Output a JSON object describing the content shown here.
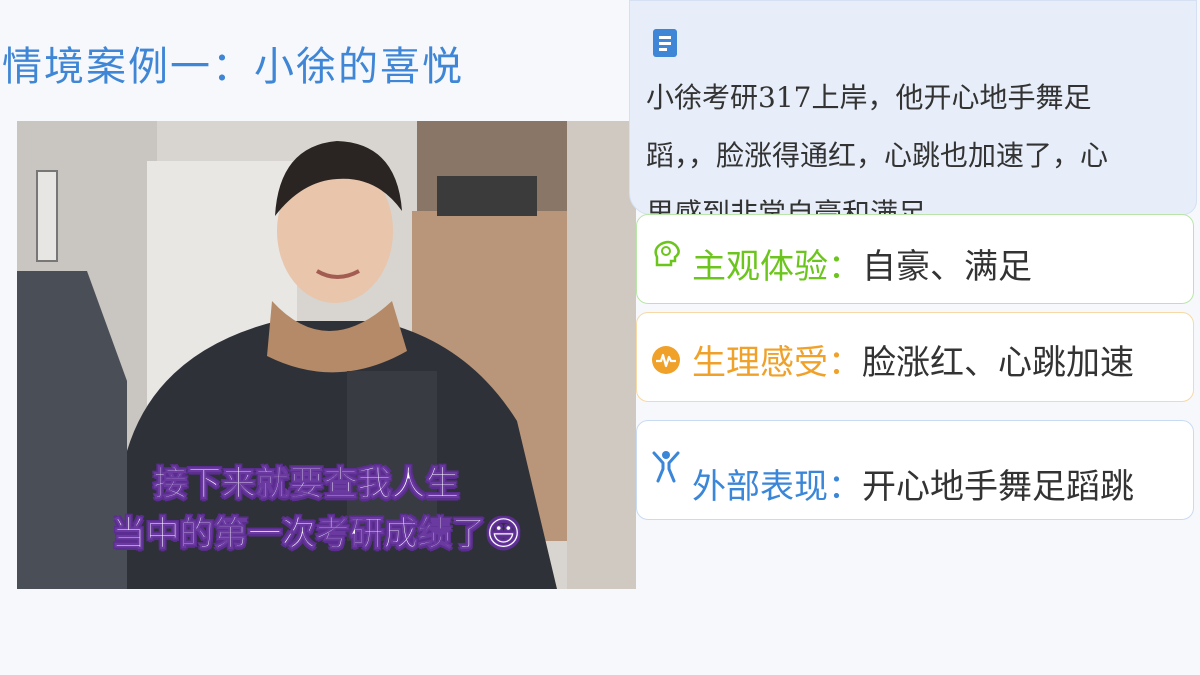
{
  "title": "情境案例一：小徐的喜悦",
  "video": {
    "caption_line1": "接下来就要查我人生",
    "caption_line2": "当中的第一次考研成绩了😃"
  },
  "scenario": {
    "icon": "document-icon",
    "line1": "小徐考研317上岸，他开心地手舞足",
    "line2": "蹈，，脸涨得通红，心跳也加速了，心",
    "line3": "里感到非常自豪和满足。"
  },
  "cards": [
    {
      "icon": "brain-head-icon",
      "key": "主观体验：",
      "value": "自豪、满足",
      "color": "#6cc51d"
    },
    {
      "icon": "pulse-icon",
      "key": "生理感受：",
      "value": "脸涨红、心跳加速",
      "color": "#f0a12a"
    },
    {
      "icon": "person-icon",
      "key": "外部表现：",
      "value": "开心地手舞足蹈跳",
      "color": "#3a86d8"
    }
  ]
}
